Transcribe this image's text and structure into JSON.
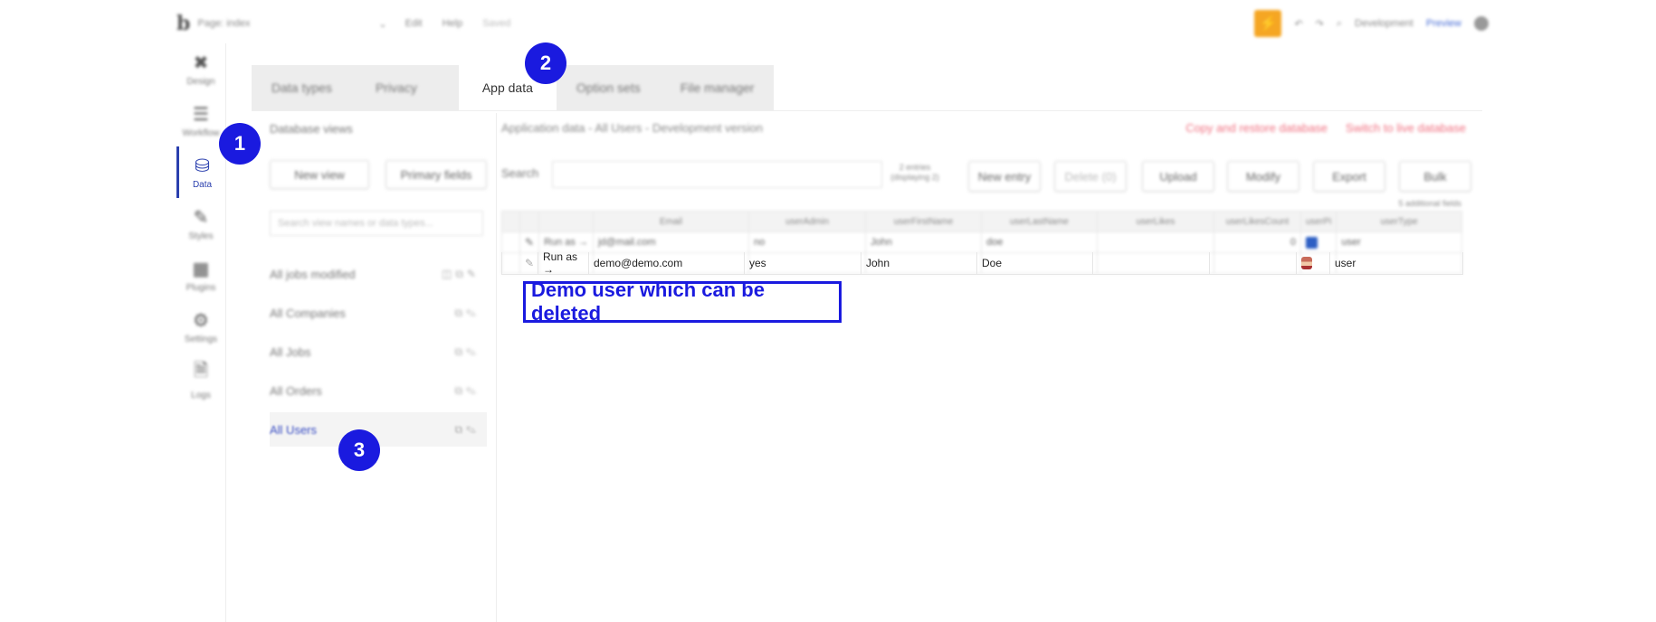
{
  "topbar": {
    "page": "Page: index",
    "menu_edit": "Edit",
    "menu_help": "Help",
    "status": "Saved",
    "env": "Development",
    "preview": "Preview"
  },
  "rail": [
    {
      "label": "Design",
      "icon": "design-icon"
    },
    {
      "label": "Workflow",
      "icon": "workflow-icon"
    },
    {
      "label": "Data",
      "icon": "database-icon",
      "active": true
    },
    {
      "label": "Styles",
      "icon": "brush-icon"
    },
    {
      "label": "Plugins",
      "icon": "plugins-icon"
    },
    {
      "label": "Settings",
      "icon": "gear-icon"
    },
    {
      "label": "Logs",
      "icon": "logs-icon"
    }
  ],
  "tabs": [
    "Data types",
    "Privacy",
    "App data",
    "Option sets",
    "File manager"
  ],
  "sidebar": {
    "title": "Database views",
    "new_view": "New view",
    "primary_fields": "Primary fields",
    "search_placeholder": "Search view names or data types...",
    "views": [
      "All jobs modified",
      "All Companies",
      "All Jobs",
      "All Orders",
      "All Users"
    ]
  },
  "main": {
    "title": "Application data - All Users - Development version",
    "copy_restore": "Copy and restore database",
    "switch_live": "Switch to live database",
    "search_label": "Search",
    "entries": "2 entries (displaying 2)",
    "buttons": [
      "New entry",
      "Delete (0)",
      "Upload",
      "Modify",
      "Export",
      "Bulk"
    ],
    "additional_fields": "5 additional fields"
  },
  "table": {
    "columns": [
      "Email",
      "userAdmin",
      "userFirstName",
      "userLastName",
      "userLikes",
      "userLikesCount",
      "userPi",
      "userType"
    ],
    "rows": [
      {
        "run": "Run as →",
        "email": "jd@mail.com",
        "admin": "no",
        "first": "John",
        "last": "doe",
        "likes": "",
        "likes_count": "0",
        "type": "user"
      },
      {
        "run": "Run as →",
        "email": "demo@demo.com",
        "admin": "yes",
        "first": "John",
        "last": "Doe",
        "likes": "",
        "likes_count": "",
        "type": "user"
      }
    ]
  },
  "annotation": "Demo user which can be deleted",
  "badges": [
    "1",
    "2",
    "3"
  ],
  "colors": {
    "accent": "#1a1adf",
    "bolt": "#f5a623",
    "danger_link": "#f07080"
  }
}
